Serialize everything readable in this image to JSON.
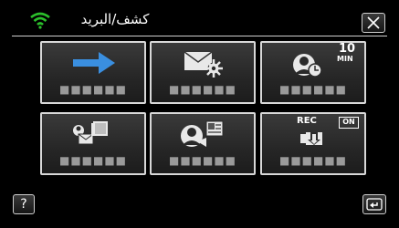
{
  "header": {
    "title": "كشف/البريد",
    "wifi_icon": "wifi-icon",
    "close_icon": "close-icon"
  },
  "tiles": [
    {
      "name": "arrow",
      "icon": "right-arrow-icon",
      "label": "■■■■■■"
    },
    {
      "name": "mail-settings",
      "icon": "mail-gear-icon",
      "label": "■■■■■■"
    },
    {
      "name": "detect-interval",
      "icon": "person-clock-icon",
      "label": "■■■■■■",
      "badge": "10",
      "badge_unit": "MIN"
    },
    {
      "name": "mail-address",
      "icon": "person-mail-book-icon",
      "label": "■■■■■■"
    },
    {
      "name": "face-detect",
      "icon": "person-photo-icon",
      "label": "■■■■■■"
    },
    {
      "name": "rec-start",
      "icon": "rec-camera-icon",
      "label": "■■■■■■",
      "badge": "REC",
      "toggle": "ON"
    }
  ],
  "footer": {
    "help_label": "?",
    "back_icon": "return-icon"
  },
  "colors": {
    "wifi": "#2bbf2b",
    "arrow": "#3a8fe0",
    "tile_border": "#d8d8d8",
    "label": "#9a9a9a"
  }
}
